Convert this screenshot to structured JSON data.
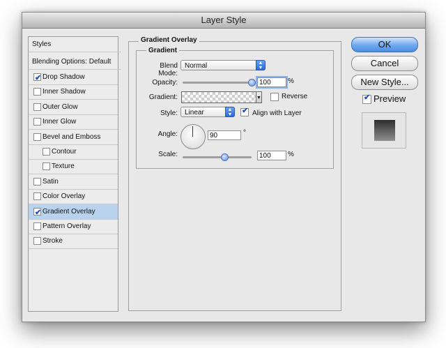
{
  "window": {
    "title": "Layer Style"
  },
  "styles_panel": {
    "header": "Styles",
    "blending": "Blending Options: Default",
    "items": [
      {
        "label": "Drop Shadow",
        "checked": true,
        "indent": false,
        "selected": false
      },
      {
        "label": "Inner Shadow",
        "checked": false,
        "indent": false,
        "selected": false
      },
      {
        "label": "Outer Glow",
        "checked": false,
        "indent": false,
        "selected": false
      },
      {
        "label": "Inner Glow",
        "checked": false,
        "indent": false,
        "selected": false
      },
      {
        "label": "Bevel and Emboss",
        "checked": false,
        "indent": false,
        "selected": false
      },
      {
        "label": "Contour",
        "checked": false,
        "indent": true,
        "selected": false
      },
      {
        "label": "Texture",
        "checked": false,
        "indent": true,
        "selected": false
      },
      {
        "label": "Satin",
        "checked": false,
        "indent": false,
        "selected": false
      },
      {
        "label": "Color Overlay",
        "checked": false,
        "indent": false,
        "selected": false
      },
      {
        "label": "Gradient Overlay",
        "checked": true,
        "indent": false,
        "selected": true
      },
      {
        "label": "Pattern Overlay",
        "checked": false,
        "indent": false,
        "selected": false
      },
      {
        "label": "Stroke",
        "checked": false,
        "indent": false,
        "selected": false
      }
    ]
  },
  "gradient_overlay": {
    "section_title": "Gradient Overlay",
    "group_title": "Gradient",
    "blend_mode": {
      "label": "Blend Mode:",
      "value": "Normal"
    },
    "opacity": {
      "label": "Opacity:",
      "value": "100",
      "unit": "%",
      "level": 100
    },
    "gradient": {
      "label": "Gradient:",
      "reverse_label": "Reverse",
      "reverse_checked": false
    },
    "style": {
      "label": "Style:",
      "value": "Linear",
      "align_label": "Align with Layer",
      "align_checked": true
    },
    "angle": {
      "label": "Angle:",
      "value": "90",
      "unit": "°"
    },
    "scale": {
      "label": "Scale:",
      "value": "100",
      "unit": "%",
      "level": 100
    }
  },
  "buttons": {
    "ok": "OK",
    "cancel": "Cancel",
    "new_style": "New Style...",
    "preview_label": "Preview",
    "preview_checked": true
  }
}
